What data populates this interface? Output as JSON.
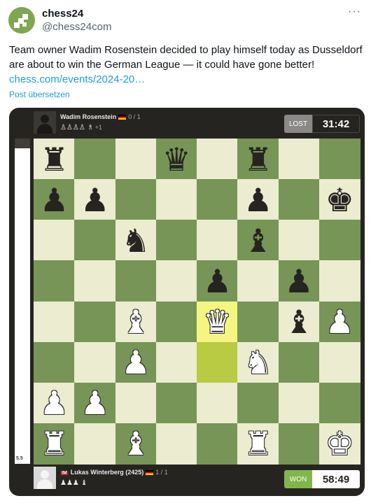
{
  "tweet": {
    "display_name": "chess24",
    "handle": "@chess24com",
    "more_label": "···",
    "text": "Team owner Wadim Rosenstein decided to play himself today as Dusseldorf are about to win the German League — it could have gone better!",
    "link": "chess.com/events/2024-20…",
    "translate_label": "Post übersetzen"
  },
  "top_player": {
    "name": "Wadim Rosenstein",
    "score": "0 / 1",
    "captured": "♙♙♙♙ ♗",
    "material": "+1",
    "result": "LOST",
    "clock": "31:42"
  },
  "bottom_player": {
    "title": "IM",
    "name": "Lukas Winterberg (2425)",
    "score": "1 / 1",
    "captured": "♟♟♟ ♝",
    "result": "WON",
    "clock": "58:49"
  },
  "eval": {
    "label": "5.5",
    "white_fraction": 0.97
  },
  "board": {
    "colors": {
      "light": "#ebecd0",
      "dark": "#779556",
      "highlight_light": "#f5f682",
      "highlight_dark": "#b9ca43"
    },
    "highlight_squares": [
      "e4",
      "e3"
    ],
    "pieces": [
      {
        "square": "a8",
        "piece": "r"
      },
      {
        "square": "d8",
        "piece": "q"
      },
      {
        "square": "f8",
        "piece": "r"
      },
      {
        "square": "a7",
        "piece": "p"
      },
      {
        "square": "b7",
        "piece": "p"
      },
      {
        "square": "f7",
        "piece": "p"
      },
      {
        "square": "h7",
        "piece": "k"
      },
      {
        "square": "c6",
        "piece": "n"
      },
      {
        "square": "f6",
        "piece": "b"
      },
      {
        "square": "e5",
        "piece": "p"
      },
      {
        "square": "g5",
        "piece": "p"
      },
      {
        "square": "c4",
        "piece": "B"
      },
      {
        "square": "e4",
        "piece": "Q"
      },
      {
        "square": "g4",
        "piece": "b"
      },
      {
        "square": "h4",
        "piece": "P"
      },
      {
        "square": "c3",
        "piece": "P"
      },
      {
        "square": "f3",
        "piece": "N"
      },
      {
        "square": "a2",
        "piece": "P"
      },
      {
        "square": "b2",
        "piece": "P"
      },
      {
        "square": "a1",
        "piece": "R"
      },
      {
        "square": "c1",
        "piece": "B"
      },
      {
        "square": "f1",
        "piece": "R"
      },
      {
        "square": "h1",
        "piece": "K"
      }
    ]
  }
}
